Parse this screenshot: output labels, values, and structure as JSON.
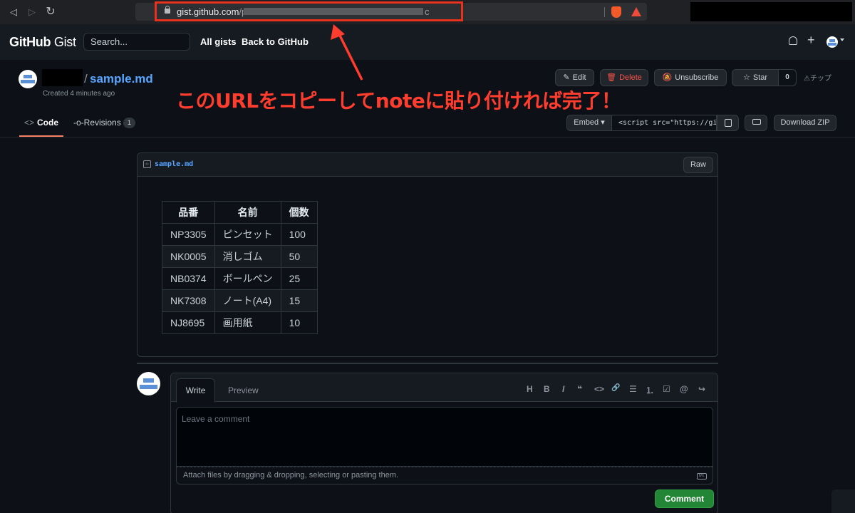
{
  "browser": {
    "url_host": "gist.github.com",
    "url_path_start": "/po",
    "url_path_end": "c"
  },
  "header": {
    "logo_main": "GitHub",
    "logo_sub": "Gist",
    "search_placeholder": "Search...",
    "nav": [
      "All gists",
      "Back to GitHub"
    ]
  },
  "gist": {
    "filename": "sample.md",
    "created": "Created 4 minutes ago",
    "actions": {
      "edit": "Edit",
      "delete": "Delete",
      "unsubscribe": "Unsubscribe",
      "star": "Star",
      "star_count": "0",
      "tip": "チップ"
    },
    "tabs": {
      "code": "Code",
      "revisions": "Revisions",
      "revisions_count": "1"
    },
    "embed": {
      "label": "Embed",
      "value": "<script src=\"https://gist.github.com/"
    },
    "download": "Download ZIP"
  },
  "annotation": "このURLをコピーしてnoteに貼り付ければ完了！",
  "file": {
    "name": "sample.md",
    "raw": "Raw",
    "table": {
      "headers": [
        "品番",
        "名前",
        "個数"
      ],
      "rows": [
        [
          "NP3305",
          "ピンセット",
          "100"
        ],
        [
          "NK0005",
          "消しゴム",
          "50"
        ],
        [
          "NB0374",
          "ボールペン",
          "25"
        ],
        [
          "NK7308",
          "ノート(A4)",
          "15"
        ],
        [
          "NJ8695",
          "画用紙",
          "10"
        ]
      ]
    }
  },
  "comment": {
    "write_tab": "Write",
    "preview_tab": "Preview",
    "placeholder": "Leave a comment",
    "attach": "Attach files by dragging & dropping, selecting or pasting them.",
    "submit": "Comment",
    "toolbar": [
      "H",
      "B",
      "I",
      "❝",
      "<>",
      "🔗",
      "☰",
      "⒈",
      "☑",
      "@",
      "↪"
    ]
  },
  "colors": {
    "accent_red": "#e8321e",
    "link_blue": "#58a6ff",
    "comment_green": "#238636"
  }
}
